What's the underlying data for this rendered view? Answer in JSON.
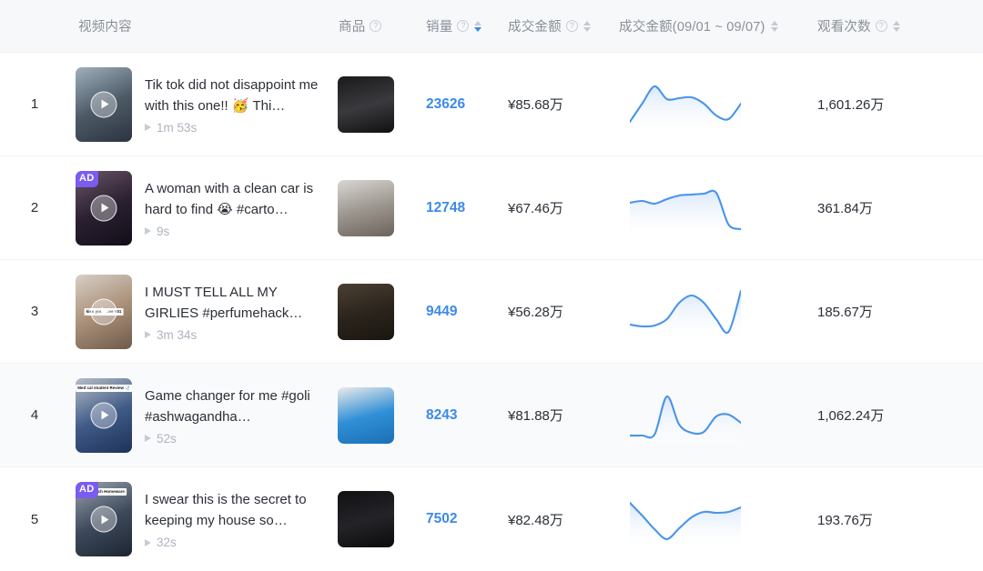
{
  "columns": [
    {
      "key": "rank",
      "label": "",
      "help": false,
      "sort": "none"
    },
    {
      "key": "video",
      "label": "视频内容",
      "help": false,
      "sort": "none"
    },
    {
      "key": "product",
      "label": "商品",
      "help": true,
      "sort": "none"
    },
    {
      "key": "sales",
      "label": "销量",
      "help": true,
      "sort": "desc"
    },
    {
      "key": "gmv",
      "label": "成交金额",
      "help": true,
      "sort": "none"
    },
    {
      "key": "gmv_range",
      "label": "成交金额(09/01 ~ 09/07)",
      "help": false,
      "sort": "none"
    },
    {
      "key": "views",
      "label": "观看次数",
      "help": true,
      "sort": "none"
    }
  ],
  "help_glyph": "?",
  "colors": {
    "accent": "#3c8ae8",
    "header_bg": "#f7f8fa",
    "row_alt_bg": "#f9fafc",
    "text": "#2b2f36",
    "muted": "#8a9099",
    "ad_badge": "#7a5cf0",
    "spark_line": "#4a94e8",
    "spark_fill_top": "#d7e6fa",
    "spark_fill_bottom": "#ffffff"
  },
  "rows": [
    {
      "rank": "1",
      "title": "Tik tok did not disappoint me with this one!! 🥳 Thi…",
      "duration": "1m 53s",
      "ad": false,
      "overlay_caption": "",
      "sales": "23626",
      "gmv": "¥85.68万",
      "views": "1,601.26万",
      "highlight": false,
      "sparkline": [
        12,
        52,
        90,
        62,
        64,
        66,
        52,
        26,
        18,
        52
      ],
      "video_palette": [
        "#9fb0bd",
        "#4c5a66",
        "#2c3440"
      ],
      "product_palette": [
        "#1a1a1c",
        "#3a3a3e",
        "#101012"
      ]
    },
    {
      "rank": "2",
      "title": "A woman with a clean car is hard to find 😭 #carto…",
      "duration": "9s",
      "ad": true,
      "overlay_caption": "",
      "sales": "12748",
      "gmv": "¥67.46万",
      "views": "361.84万",
      "highlight": false,
      "sparkline": [
        62,
        66,
        60,
        70,
        78,
        80,
        82,
        84,
        14,
        4
      ],
      "video_palette": [
        "#6c5668",
        "#2a2030",
        "#120d18"
      ],
      "product_palette": [
        "#d9d6d2",
        "#9b958e",
        "#6a645d"
      ]
    },
    {
      "rank": "3",
      "title": "I MUST TELL ALL MY GIRLIES #perfumehack…",
      "duration": "3m 34s",
      "ad": false,
      "overlay_caption": "kiss your love #01",
      "sales": "9449",
      "gmv": "¥56.28万",
      "views": "185.67万",
      "highlight": false,
      "sparkline": [
        22,
        18,
        20,
        34,
        70,
        86,
        70,
        34,
        6,
        96
      ],
      "video_palette": [
        "#d7cfc6",
        "#a98f78",
        "#6d5a4a"
      ],
      "product_palette": [
        "#4a3f33",
        "#2b241c",
        "#191510"
      ]
    },
    {
      "rank": "4",
      "title": "Game changer for me #goli #ashwagandha…",
      "duration": "52s",
      "ad": false,
      "overlay_caption": "Med cal student Review 🩺",
      "sales": "8243",
      "gmv": "¥81.88万",
      "views": "1,062.24万",
      "highlight": true,
      "sparkline": [
        6,
        6,
        8,
        92,
        30,
        12,
        14,
        48,
        52,
        34
      ],
      "video_palette": [
        "#b8bfc6",
        "#3f5a86",
        "#1d3258"
      ],
      "product_palette": [
        "#eceaea",
        "#2f8fd6",
        "#1c6fb5"
      ]
    },
    {
      "rank": "5",
      "title": "I swear this is the secret to keeping my house so…",
      "duration": "32s",
      "ad": true,
      "overlay_caption": "Mrs Hinch Homeware",
      "sales": "7502",
      "gmv": "¥82.48万",
      "views": "193.76万",
      "highlight": false,
      "sparkline": [
        86,
        58,
        28,
        6,
        30,
        54,
        66,
        64,
        66,
        76
      ],
      "video_palette": [
        "#9aa4ad",
        "#3d4a5c",
        "#1d2430"
      ],
      "product_palette": [
        "#111114",
        "#242428",
        "#0b0b0d"
      ]
    }
  ]
}
